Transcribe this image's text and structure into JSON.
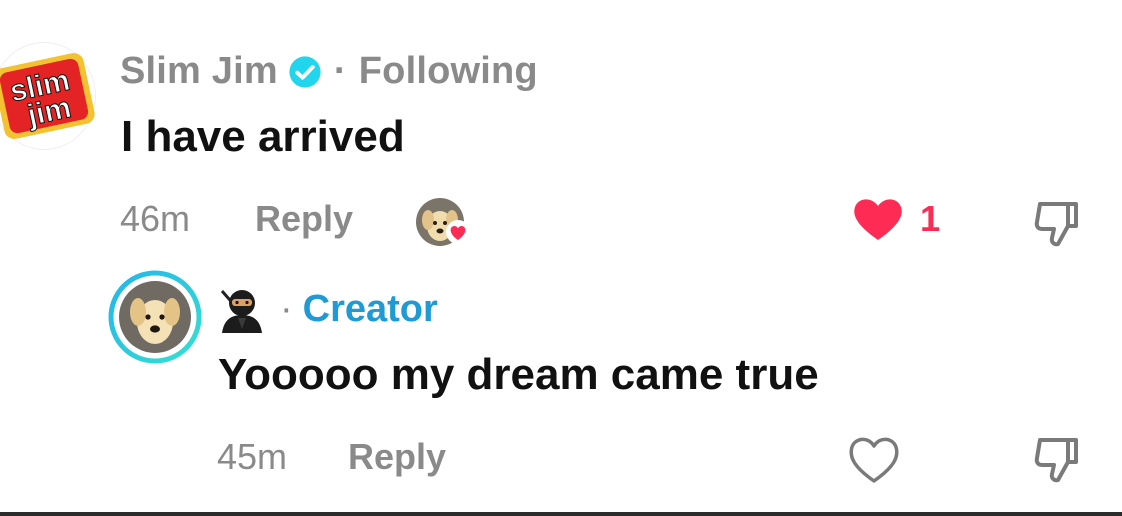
{
  "comment": {
    "author": "Slim Jim",
    "separator": "·",
    "relationship": "Following",
    "text": "I have arrived",
    "time": "46m",
    "reply_label": "Reply",
    "like_count": "1",
    "avatar_logo_text": [
      "slim",
      "jim"
    ]
  },
  "reply": {
    "author_badge": "Creator",
    "separator": "·",
    "text": "Yooooo my dream came true",
    "time": "45m",
    "reply_label": "Reply"
  },
  "colors": {
    "like_red": "#fe2c55",
    "creator_blue": "#1e9bd7",
    "verified_blue": "#20d5ec",
    "muted_gray": "#8a8a8a"
  },
  "icons": {
    "verified": "verified-badge-icon",
    "like": "heart-filled-icon",
    "like_outline": "heart-outline-icon",
    "dislike": "thumbs-down-icon",
    "ninja": "ninja-emoji-icon"
  }
}
